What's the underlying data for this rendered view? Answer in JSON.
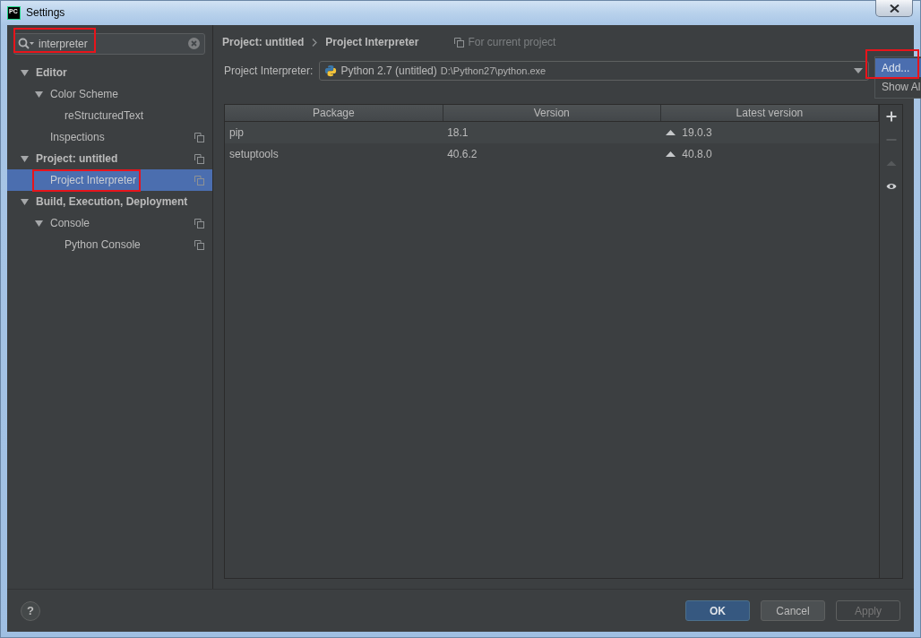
{
  "window": {
    "logo_text": "PC",
    "title": "Settings"
  },
  "sidebar": {
    "search": {
      "value": "interpreter",
      "highlighted": true
    },
    "tree": [
      {
        "label": "Editor",
        "expanded": true,
        "selected": false,
        "highlighted": false,
        "project_scoped": false,
        "children": [
          {
            "label": "Color Scheme",
            "expanded": true,
            "selected": false,
            "highlighted": false,
            "project_scoped": false,
            "children": [
              {
                "label": "reStructuredText",
                "selected": false,
                "highlighted": false,
                "project_scoped": false
              }
            ]
          },
          {
            "label": "Inspections",
            "selected": false,
            "highlighted": false,
            "project_scoped": true
          }
        ]
      },
      {
        "label": "Project: untitled",
        "expanded": true,
        "selected": false,
        "highlighted": false,
        "project_scoped": true,
        "children": [
          {
            "label": "Project Interpreter",
            "selected": true,
            "highlighted": true,
            "project_scoped": true
          }
        ]
      },
      {
        "label": "Build, Execution, Deployment",
        "expanded": true,
        "selected": false,
        "highlighted": false,
        "project_scoped": false,
        "children": [
          {
            "label": "Console",
            "expanded": true,
            "selected": false,
            "highlighted": false,
            "project_scoped": true,
            "children": [
              {
                "label": "Python Console",
                "selected": false,
                "highlighted": false,
                "project_scoped": true
              }
            ]
          }
        ]
      }
    ]
  },
  "main": {
    "breadcrumb": [
      "Project: untitled",
      "Project Interpreter"
    ],
    "scope_note": "For current project",
    "interpreter": {
      "label": "Project Interpreter:",
      "name": "Python 2.7 (untitled)",
      "path": "D:\\Python27\\python.exe"
    },
    "interpreter_menu": [
      {
        "label": "Add...",
        "selected": true,
        "highlighted": true
      },
      {
        "label": "Show Al",
        "selected": false,
        "highlighted": false
      }
    ],
    "packages": {
      "columns": [
        "Package",
        "Version",
        "Latest version"
      ],
      "rows": [
        {
          "package": "pip",
          "version": "18.1",
          "latest": "19.0.3",
          "upgrade_available": true
        },
        {
          "package": "setuptools",
          "version": "40.6.2",
          "latest": "40.8.0",
          "upgrade_available": true
        }
      ]
    },
    "toolbar": [
      {
        "kind": "install",
        "disabled": false
      },
      {
        "kind": "uninstall",
        "disabled": true
      },
      {
        "kind": "upgrade",
        "disabled": true
      },
      {
        "kind": "show_early_releases",
        "disabled": false
      }
    ]
  },
  "footer": {
    "help_label": "?",
    "buttons": [
      {
        "label": "OK",
        "kind": "primary",
        "disabled": false
      },
      {
        "label": "Cancel",
        "kind": "secondary",
        "disabled": false
      },
      {
        "label": "Apply",
        "kind": "secondary",
        "disabled": true
      }
    ]
  }
}
